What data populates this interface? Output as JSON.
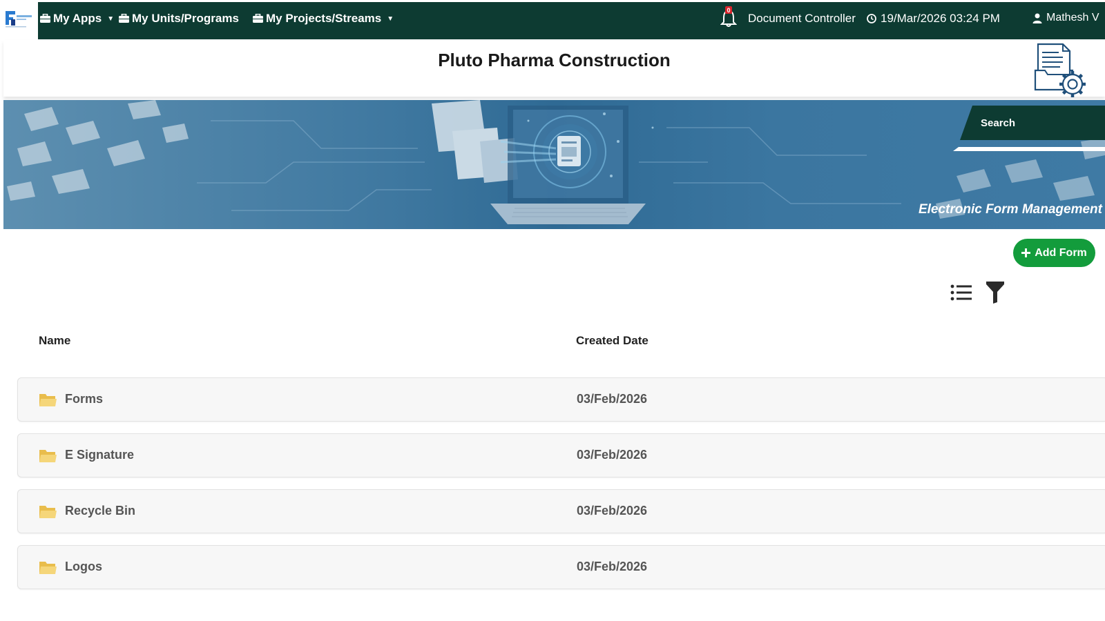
{
  "nav": {
    "my_apps": "My Apps",
    "my_units": "My Units/Programs",
    "my_projects": "My Projects/Streams",
    "notification_count": "0",
    "role": "Document Controller",
    "datetime": "19/Mar/2026 03:24 PM",
    "user": "Mathesh V"
  },
  "header": {
    "title": "Pluto Pharma Construction"
  },
  "banner": {
    "search_placeholder": "Search",
    "tagline": "Electronic Form Management"
  },
  "toolbar": {
    "add_form_label": "Add Form"
  },
  "table": {
    "headers": {
      "name": "Name",
      "created_date": "Created Date"
    },
    "rows": [
      {
        "name": "Forms",
        "date": "03/Feb/2026"
      },
      {
        "name": "E Signature",
        "date": "03/Feb/2026"
      },
      {
        "name": "Recycle Bin",
        "date": "03/Feb/2026"
      },
      {
        "name": "Logos",
        "date": "03/Feb/2026"
      }
    ]
  },
  "colors": {
    "navbar": "#0d3b32",
    "add_button": "#139c3c",
    "folder": "#f2cd6a",
    "banner": "#3f78a0"
  },
  "icons": [
    "app-logo-icon",
    "briefcase-icon",
    "caret-down-icon",
    "bell-icon",
    "clock-icon",
    "user-icon",
    "document-settings-icon",
    "plus-icon",
    "list-view-icon",
    "filter-icon",
    "folder-icon"
  ]
}
